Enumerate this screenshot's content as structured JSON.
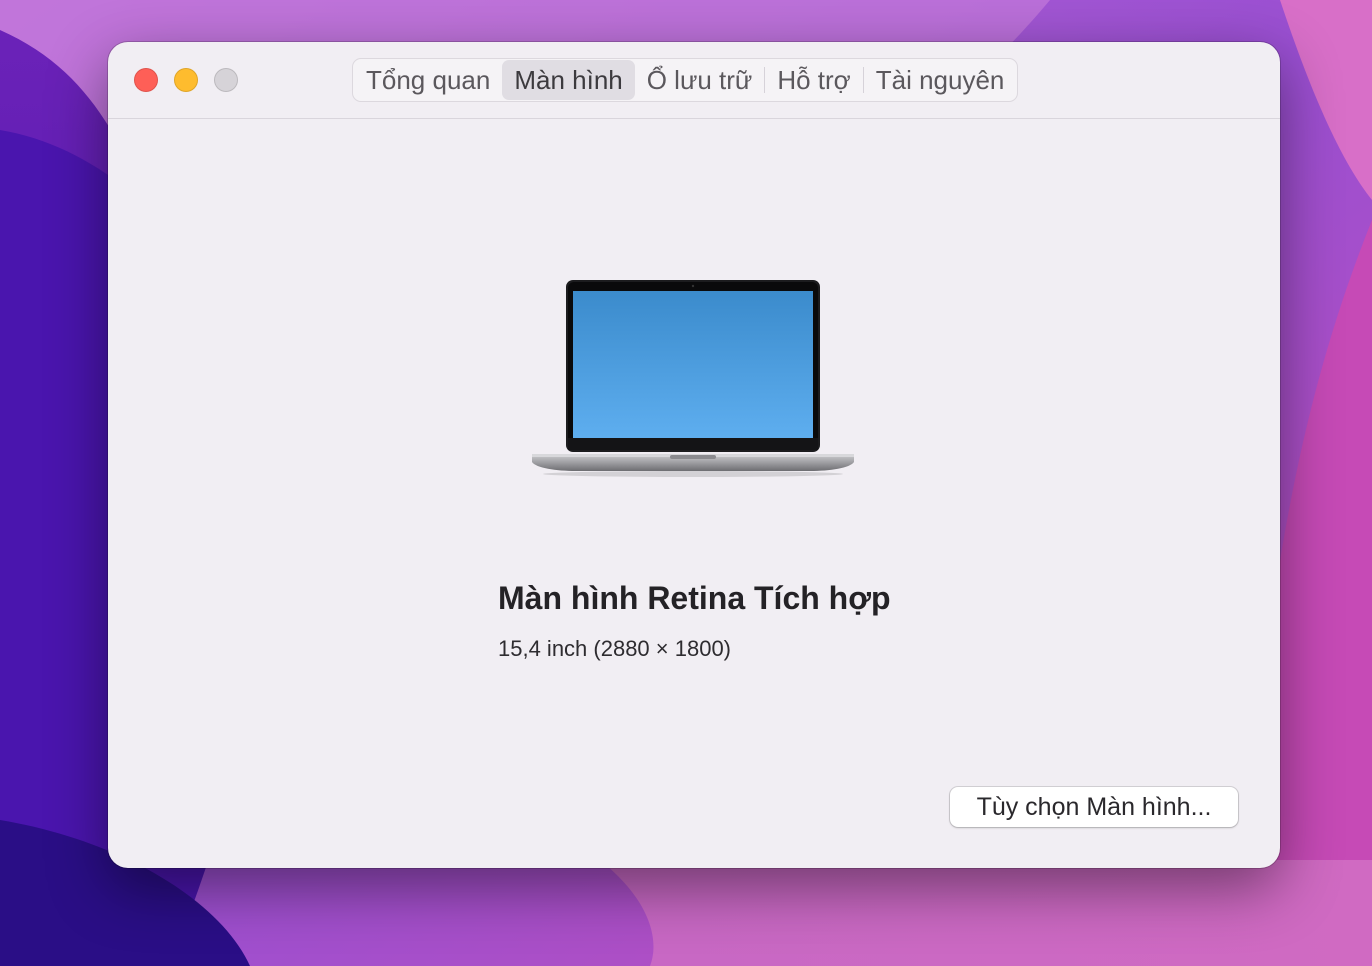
{
  "window": {
    "controls": {
      "close": "close-icon",
      "minimize": "minimize-icon",
      "zoom": "zoom-icon"
    },
    "tabs": [
      {
        "label": "Tổng quan",
        "active": false
      },
      {
        "label": "Màn hình",
        "active": true
      },
      {
        "label": "Ổ lưu trữ",
        "active": false
      },
      {
        "label": "Hỗ trợ",
        "active": false
      },
      {
        "label": "Tài nguyên",
        "active": false
      }
    ]
  },
  "display": {
    "image_icon": "macbook-pro-laptop-icon",
    "name": "Màn hình Retina Tích hợp",
    "spec": "15,4 inch (2880 × 1800)",
    "options_button_label": "Tùy chọn Màn hình..."
  },
  "colors": {
    "close": "#fe5f57",
    "minimize": "#febc2e",
    "zoom_inactive": "#d6d3d8",
    "window_bg": "#f1eef3",
    "screen_top": "#3b8bcc",
    "screen_bottom": "#5eaeef"
  }
}
